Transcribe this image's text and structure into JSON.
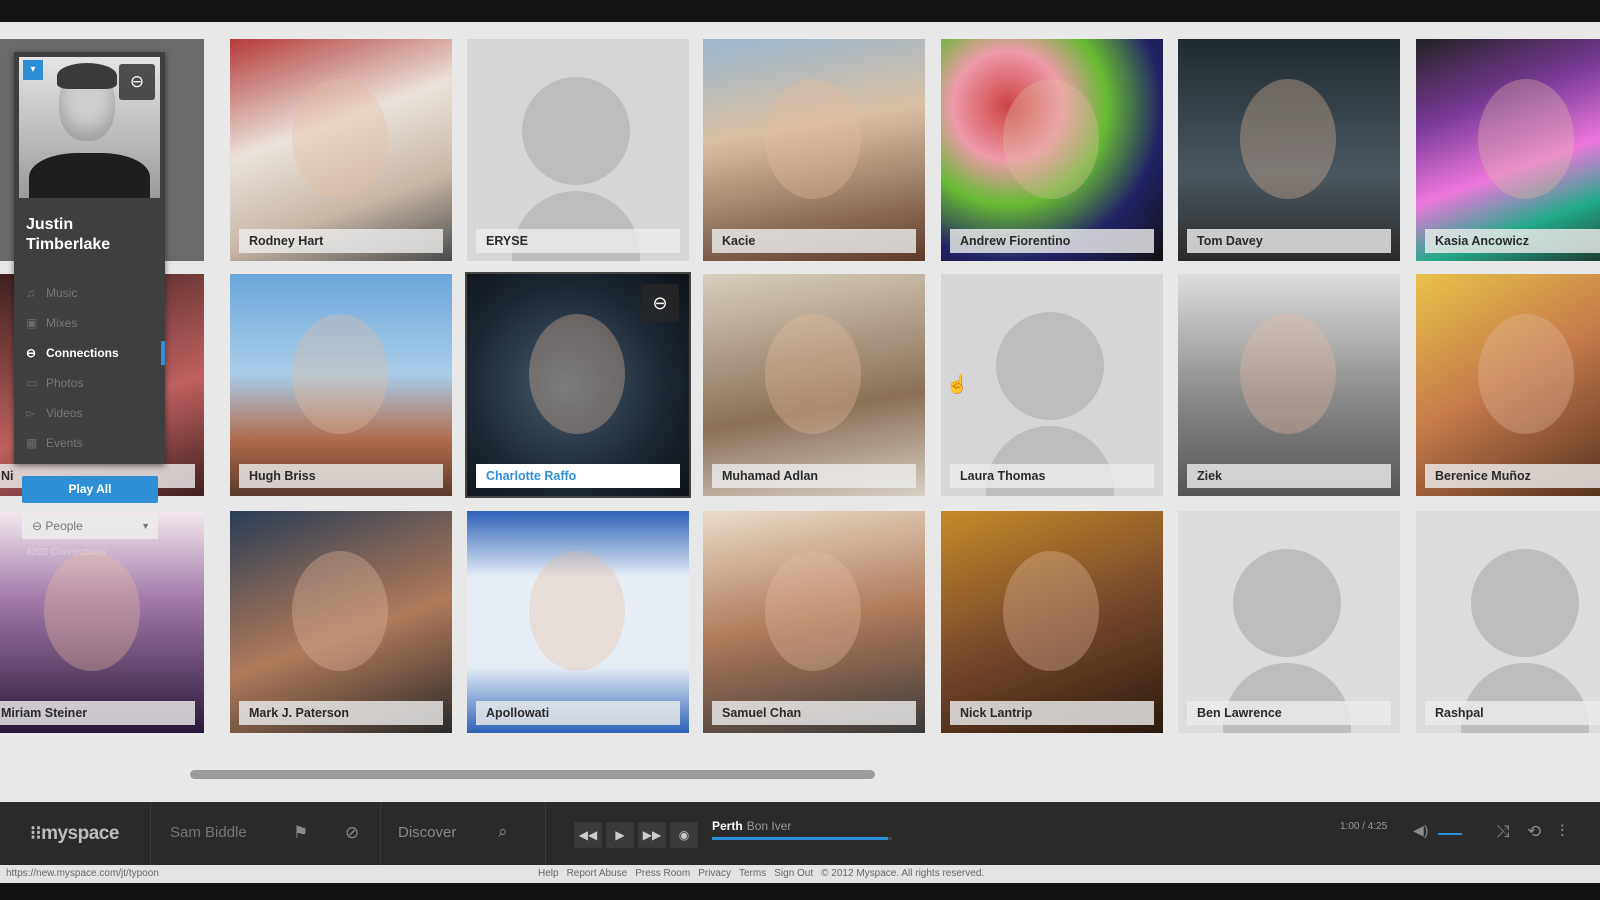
{
  "sidebar": {
    "artist_name": "Justin Timberlake",
    "menu": [
      {
        "label": "Music",
        "icon": "music-icon"
      },
      {
        "label": "Mixes",
        "icon": "mixes-icon"
      },
      {
        "label": "Connections",
        "icon": "connections-icon",
        "active": true
      },
      {
        "label": "Photos",
        "icon": "photos-icon"
      },
      {
        "label": "Videos",
        "icon": "videos-icon"
      },
      {
        "label": "Events",
        "icon": "events-icon"
      }
    ],
    "play_all_label": "Play All",
    "filter_select": "People",
    "connections_count": "4203 Connections"
  },
  "grid": [
    {
      "name": "",
      "hidden": true
    },
    {
      "name": "Rodney Hart"
    },
    {
      "name": "ERYSE",
      "placeholder": true
    },
    {
      "name": "Kacie"
    },
    {
      "name": "Andrew Fiorentino"
    },
    {
      "name": "Tom Davey"
    },
    {
      "name": "Kasia Ancowicz"
    },
    {
      "name": "Ni"
    },
    {
      "name": "Hugh Briss"
    },
    {
      "name": "Charlotte Raffo",
      "selected": true
    },
    {
      "name": "Muhamad Adlan"
    },
    {
      "name": "Laura Thomas",
      "placeholder": true
    },
    {
      "name": "Ziek"
    },
    {
      "name": "Berenice Muñoz"
    },
    {
      "name": "Miriam Steiner"
    },
    {
      "name": "Mark J. Paterson"
    },
    {
      "name": "Apollowati"
    },
    {
      "name": "Samuel Chan"
    },
    {
      "name": "Nick Lantrip"
    },
    {
      "name": "Ben Lawrence",
      "placeholder": true
    },
    {
      "name": "Rashpal",
      "placeholder": true
    }
  ],
  "player": {
    "logo": "myspace",
    "user_name": "Sam Biddle",
    "discover_label": "Discover",
    "track_title": "Perth",
    "track_artist": "Bon Iver",
    "progress": 0.98,
    "time": "1:00 / 4:25"
  },
  "footer": {
    "url": "https://new.myspace.com/jt/typoon",
    "links": [
      "Help",
      "Report Abuse",
      "Press Room",
      "Privacy",
      "Terms",
      "Sign Out",
      "© 2012 Myspace. All rights reserved."
    ]
  },
  "colors": {
    "accent": "#2f8fd6",
    "sidebar_bg": "#3f3f3f",
    "player_bg": "#2a2a2a"
  }
}
